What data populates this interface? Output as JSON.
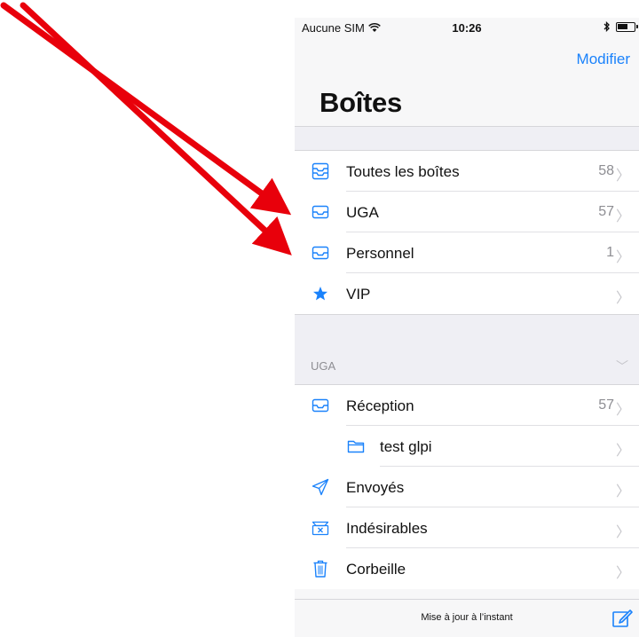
{
  "status_bar": {
    "carrier": "Aucune SIM",
    "time": "10:26",
    "icons": [
      "wifi-icon",
      "bluetooth-icon",
      "battery-icon"
    ]
  },
  "nav": {
    "edit_label": "Modifier",
    "title": "Boîtes"
  },
  "mailboxes": [
    {
      "label": "Toutes les boîtes",
      "count": "58",
      "icon": "all-inboxes-icon"
    },
    {
      "label": "UGA",
      "count": "57",
      "icon": "inbox-icon"
    },
    {
      "label": "Personnel",
      "count": "1",
      "icon": "inbox-icon"
    },
    {
      "label": "VIP",
      "count": "",
      "icon": "star-icon"
    }
  ],
  "account_section": {
    "header": "UGA",
    "folders": [
      {
        "label": "Réception",
        "count": "57",
        "icon": "inbox-icon"
      },
      {
        "label": "test glpi",
        "count": "",
        "icon": "folder-icon"
      },
      {
        "label": "Envoyés",
        "count": "",
        "icon": "sent-icon"
      },
      {
        "label": "Indésirables",
        "count": "",
        "icon": "junk-icon"
      },
      {
        "label": "Corbeille",
        "count": "",
        "icon": "trash-icon"
      }
    ]
  },
  "toolbar": {
    "status_text": "Mise à jour à l’instant",
    "compose_icon": "compose-icon"
  },
  "colors": {
    "accent": "#1a82fb",
    "arrow": "#e8000b",
    "secondary_text": "#8e8e93",
    "group_background": "#efeff4"
  }
}
